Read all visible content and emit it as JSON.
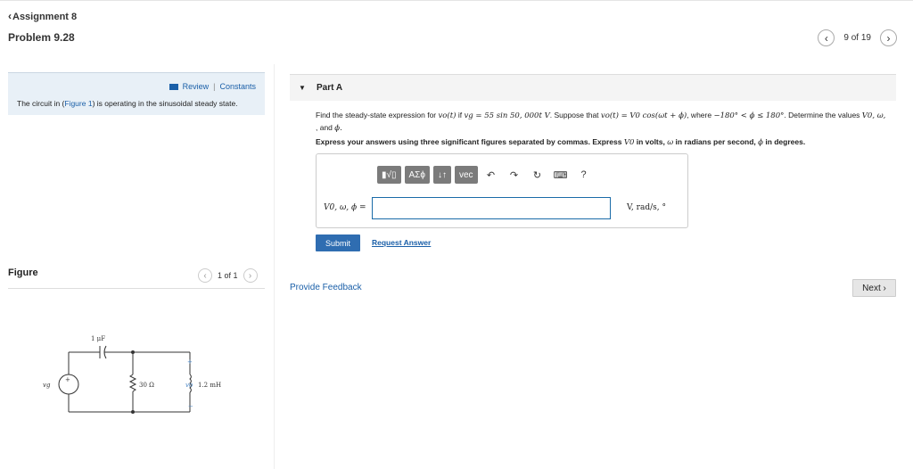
{
  "header": {
    "back_label": "Assignment 8",
    "problem_title": "Problem 9.28",
    "pager_text": "9 of 19"
  },
  "left_panel": {
    "review_label": "Review",
    "separator": "|",
    "constants_label": "Constants",
    "circuit_text_before": "The circuit in (",
    "figure_link": "Figure 1",
    "circuit_text_after": ") is operating in the sinusoidal steady state."
  },
  "figure": {
    "label": "Figure",
    "count": "1 of 1",
    "capacitor_label": "1 μF",
    "source_label": "vg",
    "resistor_label": "30 Ω",
    "output_label": "vo",
    "inductor_label": "1.2 mH",
    "plus": "+",
    "minus": "−"
  },
  "part": {
    "title": "Part A",
    "question_1": "Find the steady-state expression for",
    "question_2": "if",
    "question_3": ". Suppose that",
    "question_4": ", where",
    "question_5": ". Determine the values",
    "question_6": ", and",
    "vo_t": "vo(t)",
    "vg_expr": "vg = 55 sin 50, 000t V",
    "vo_expr": "vo(t) = V0 cos(ωt + ϕ)",
    "range_expr": "−180° < ϕ ≤ 180°",
    "values_list": "V0, ω,",
    "phi": "ϕ.",
    "instructions_1": "Express your answers using three significant figures separated by commas. Express",
    "instructions_2": "in volts,",
    "instructions_3": "in radians per second,",
    "instructions_4": "in degrees.",
    "v0": "V0",
    "omega": "ω",
    "phi_sym": "ϕ"
  },
  "toolbar": {
    "templates": "▮√▯",
    "greek": "ΑΣϕ",
    "arrows": "↓↑",
    "vec": "vec",
    "undo": "↶",
    "redo": "↷",
    "reset": "↻",
    "keyboard": "⌨",
    "help": "?"
  },
  "answer": {
    "label": "V0, ω, ϕ =",
    "value": "",
    "units": "V, rad/s, °"
  },
  "actions": {
    "submit": "Submit",
    "request_answer": "Request Answer",
    "provide_feedback": "Provide Feedback",
    "next": "Next"
  },
  "icons": {
    "back": "chevron-left-icon",
    "prev": "chevron-left-icon",
    "next": "chevron-right-icon",
    "review": "review-icon",
    "collapse": "triangle-down-icon"
  },
  "colors": {
    "link": "#1a5fa8",
    "submit_bg": "#2f6db1",
    "panel_bg": "#e8f0f7",
    "toolbar_btn": "#7b7b7b"
  }
}
